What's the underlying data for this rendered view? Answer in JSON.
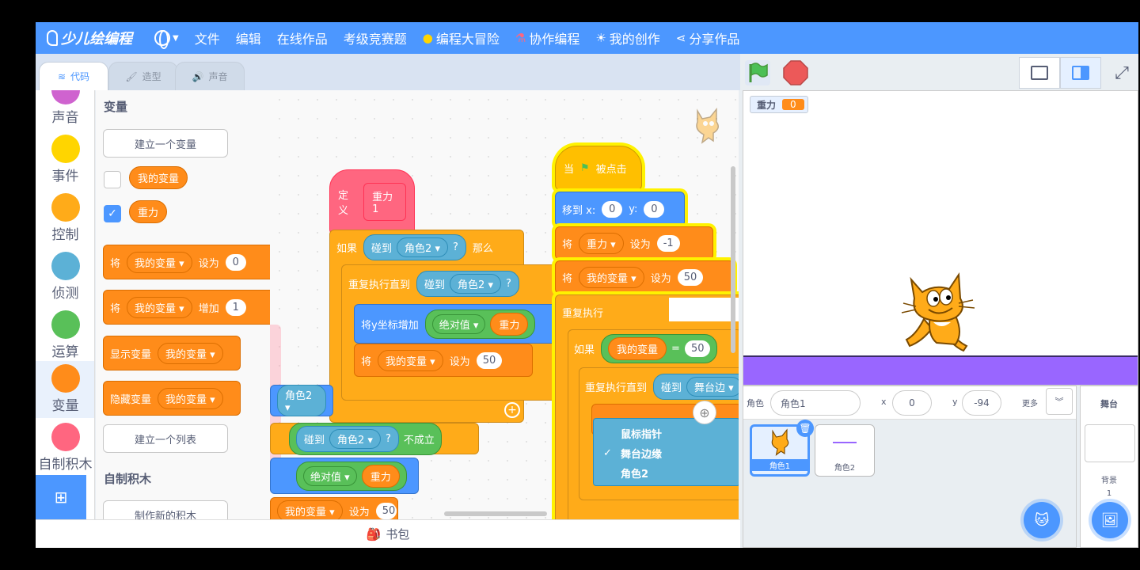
{
  "menubar": {
    "logo_text": "少儿绘编程",
    "items": [
      "文件",
      "编辑",
      "在线作品",
      "考级竞赛题"
    ],
    "icon_items": [
      {
        "icon": "bulb-icon",
        "label": "编程大冒险"
      },
      {
        "icon": "flask-icon",
        "label": "协作编程"
      },
      {
        "icon": "sun-icon",
        "label": "我的创作"
      },
      {
        "icon": "share-icon",
        "label": "分享作品"
      }
    ]
  },
  "tabs": {
    "code": "代码",
    "costumes": "造型",
    "sounds": "声音"
  },
  "categories": [
    {
      "label": "声音",
      "color": "#cf63cf"
    },
    {
      "label": "事件",
      "color": "#ffd500"
    },
    {
      "label": "控制",
      "color": "#ffab19"
    },
    {
      "label": "侦测",
      "color": "#5cb1d6"
    },
    {
      "label": "运算",
      "color": "#59c059"
    },
    {
      "label": "变量",
      "color": "#ff8c1a"
    },
    {
      "label": "自制积木",
      "color": "#ff6680"
    }
  ],
  "palette": {
    "variables_heading": "变量",
    "make_variable": "建立一个变量",
    "var1": "我的变量",
    "var2": "重力",
    "set_label": "将",
    "set_to": "设为",
    "set_value": "0",
    "change_by": "增加",
    "change_value": "1",
    "show_var": "显示变量",
    "hide_var": "隐藏变量",
    "make_list": "建立一个列表",
    "my_blocks_heading": "自制积木",
    "make_block": "制作新的积木"
  },
  "scripts": {
    "define": "定义",
    "gravity1": "重力1",
    "if": "如果",
    "touching": "碰到",
    "sprite2": "角色2",
    "q": "?",
    "then": "那么",
    "repeat_until": "重复执行直到",
    "change_y": "将y坐标增加",
    "abs": "绝对值",
    "gravity": "重力",
    "set": "将",
    "my_var": "我的变量",
    "set_to": "设为",
    "fifty": "50",
    "not_true": "不成立",
    "when": "当",
    "clicked": "被点击",
    "goto_x": "移到 x:",
    "y": "y:",
    "zero": "0",
    "minus_one": "-1",
    "forever": "重复执行",
    "equals": "=",
    "edge": "舞台边",
    "plus": "+"
  },
  "context_menu": {
    "items": [
      "鼠标指针",
      "舞台边缘",
      "角色2"
    ],
    "checked": "舞台边缘"
  },
  "backpack": "书包",
  "stage": {
    "monitor_label": "重力",
    "monitor_value": "0"
  },
  "sprite_info": {
    "sprite_label": "角色",
    "sprite_name": "角色1",
    "x_label": "x",
    "x_value": "0",
    "y_label": "y",
    "y_value": "-94",
    "more": "更多"
  },
  "sprites": [
    {
      "name": "角色1"
    },
    {
      "name": "角色2"
    }
  ],
  "stage_pane": {
    "title": "舞台",
    "backdrops_label": "背景",
    "backdrops_count": "1"
  }
}
